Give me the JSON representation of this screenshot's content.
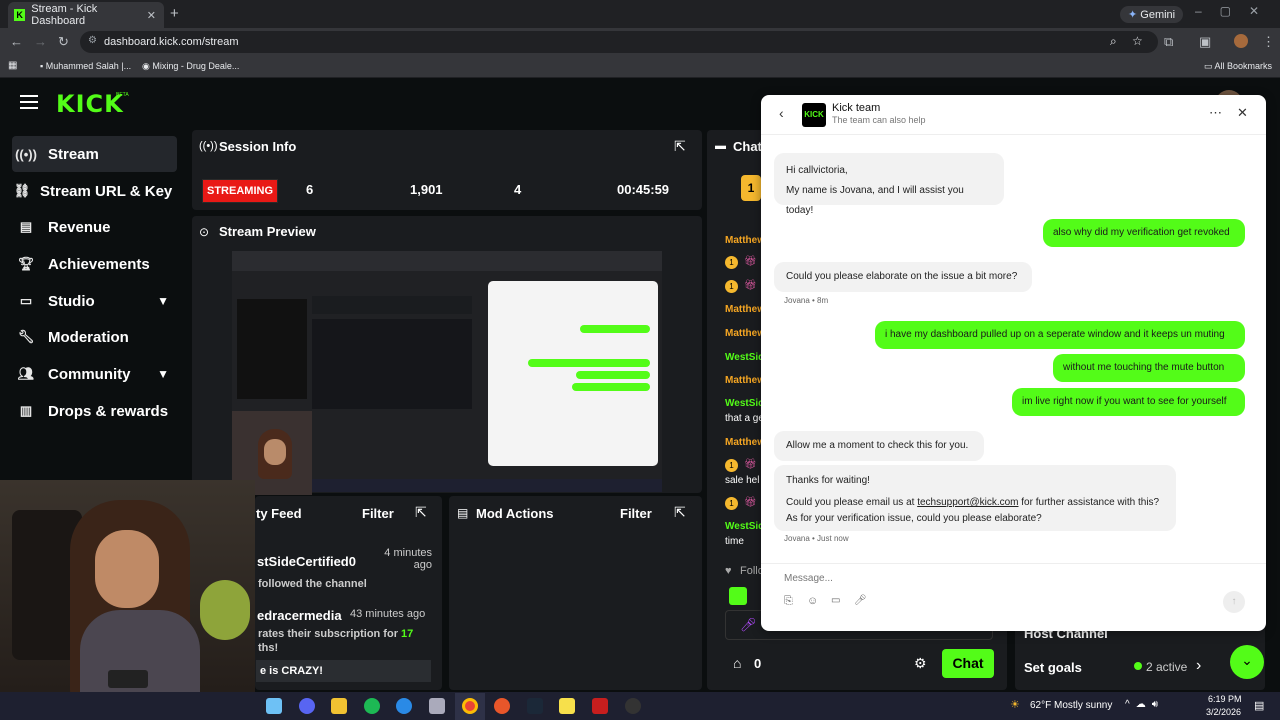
{
  "browser": {
    "tab_title": "Stream - Kick Dashboard",
    "tab_close": "✕",
    "new_tab": "+",
    "url": "dashboard.kick.com/stream",
    "gemini": "Gemini",
    "bookmarks": [
      "Muhammed Salah |...",
      "Mixing - Drug Deale..."
    ],
    "all_bookmarks": "All Bookmarks"
  },
  "app": {
    "logo": "KICK",
    "beta": "BETA"
  },
  "sidebar": {
    "items": [
      {
        "label": "Stream",
        "icon": "broadcast-icon"
      },
      {
        "label": "Stream URL & Key",
        "icon": "link-icon"
      },
      {
        "label": "Revenue",
        "icon": "chart-icon"
      },
      {
        "label": "Achievements",
        "icon": "trophy-icon"
      },
      {
        "label": "Studio",
        "icon": "display-icon"
      },
      {
        "label": "Moderation",
        "icon": "wrench-icon"
      },
      {
        "label": "Community",
        "icon": "users-icon"
      },
      {
        "label": "Drops & rewards",
        "icon": "gift-icon"
      }
    ]
  },
  "session": {
    "title": "Session Info",
    "status": "STREAMING",
    "viewers": "6",
    "followers": "1,901",
    "subs": "4",
    "duration": "00:45:59"
  },
  "preview": {
    "title": "Stream Preview"
  },
  "activity": {
    "title": "ty Feed",
    "filter": "Filter",
    "items": [
      {
        "name": "stSideCertified0",
        "time": "4 minutes ago",
        "text": "followed the channel"
      },
      {
        "name": "edracermedia",
        "time": "43 minutes ago",
        "text_a": "rates their subscription for ",
        "months": "17",
        "text_b": "ths!",
        "message": "e is CRAZY!"
      }
    ]
  },
  "modactions": {
    "title": "Mod Actions",
    "filter": "Filter"
  },
  "chat": {
    "title": "Chat",
    "names": [
      "Matthew",
      "Matthew",
      "Matthew",
      "WestSide",
      "Matthew",
      "WestSide",
      "Matthew",
      "WestSide"
    ],
    "snippets": [
      "that a ge",
      "sale hel",
      "time"
    ],
    "follow": "Follo",
    "send": "Chat",
    "count": "0"
  },
  "quick": {
    "host": "Host Channel",
    "goals": "Set goals",
    "active": "2 active"
  },
  "widget": {
    "name": "Kick team",
    "subtitle": "The team can also help",
    "messages": {
      "greet1": "Hi callvictoria,",
      "greet2": "My name is Jovana, and I will assist you today!",
      "out1": "also why did my verification get revoked",
      "in2": "Could you please elaborate on the issue a bit more?",
      "meta2": "Jovana • 8m",
      "out2": "i have my dashboard pulled up on a seperate window and it keeps un muting",
      "out3": "without me touching the mute button",
      "out4": "im live right now if you want to see for yourself",
      "in3": "Allow me a moment to check this for you.",
      "in4a": "Thanks for waiting!",
      "in4b": "Could you please email us at ",
      "email": "techsupport@kick.com",
      "in4c": " for further assistance with this?",
      "in4d": "As for your verification issue, could you please elaborate?",
      "meta4": "Jovana • Just now"
    },
    "placeholder": "Message..."
  },
  "taskbar": {
    "weather": "62°F  Mostly sunny",
    "time": "6:19 PM",
    "date": "3/2/2026"
  },
  "colors": {
    "kick_green": "#53fc18",
    "live_red": "#e91916"
  }
}
